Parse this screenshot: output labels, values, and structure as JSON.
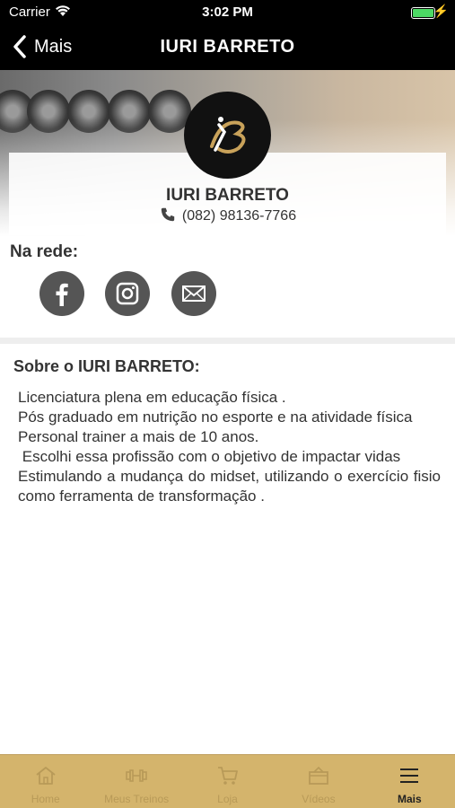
{
  "status_bar": {
    "carrier": "Carrier",
    "time": "3:02 PM",
    "battery_level": 1.0,
    "battery_color": "#4cd964"
  },
  "nav": {
    "back_label": "Mais",
    "title": "IURI BARRETO"
  },
  "profile": {
    "name": "IURI BARRETO",
    "phone": "(082) 98136-7766",
    "logo_text": "B",
    "phone_icon": "phone-icon"
  },
  "network": {
    "label": "Na rede:",
    "links": [
      {
        "icon": "facebook-icon"
      },
      {
        "icon": "instagram-icon"
      },
      {
        "icon": "email-icon"
      }
    ]
  },
  "about": {
    "title": "Sobre o IURI BARRETO:",
    "paragraphs": [
      "Licenciatura plena em educação física .",
      "Pós graduado em nutrição no esporte e na atividade física",
      "Personal trainer a mais de 10 anos.",
      " Escolhi essa profissão com o objetivo de impactar vidas",
      "Estimulando a mudança do midset, utilizando o exercício fisio como ferramenta de transformação ."
    ]
  },
  "tabs": [
    {
      "label": "Home",
      "icon": "home-icon",
      "active": false
    },
    {
      "label": "Meus Treinos",
      "icon": "dumbbell-icon",
      "active": false
    },
    {
      "label": "Loja",
      "icon": "cart-icon",
      "active": false
    },
    {
      "label": "Vídeos",
      "icon": "video-icon",
      "active": false
    },
    {
      "label": "Mais",
      "icon": "menu-icon",
      "active": true
    }
  ],
  "colors": {
    "tab_bar": "#d4b46c",
    "header": "#000000",
    "social_icon_bg": "#555555"
  }
}
